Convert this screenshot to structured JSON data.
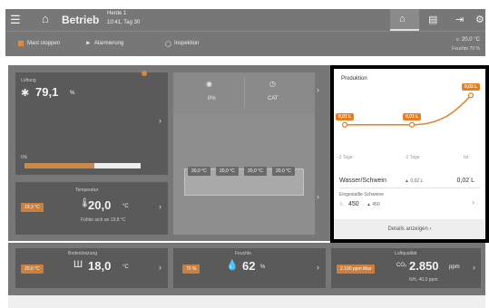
{
  "topbar": {
    "title": "Betrieb",
    "subtitle_line1": "Herde 1",
    "subtitle_line2": "10:41, Tag 30",
    "icons": [
      "menu-icon",
      "home-icon",
      "barn-icon",
      "document-icon",
      "logout-icon",
      "settings-icon"
    ]
  },
  "actions": {
    "stop_label": "Mast stoppen",
    "alarm_label": "Alarmierung",
    "inspection_label": "Inspektion",
    "outside_temp": "☼ 20,0 °C",
    "outside_humidity": "Feuchte 70 %"
  },
  "main": {
    "luftung": {
      "label": "Lüftung",
      "value": "79,1",
      "unit": "%",
      "bar_start": "0%",
      "bar_fill": 0.6
    },
    "center": {
      "left_value": "0%",
      "right_value": "CAT"
    },
    "temperatur": {
      "label": "Temperatur",
      "badge": "19,3 °C",
      "value": "20,0",
      "unit": "°C",
      "note": "Fühler sich an 19,8 °C"
    },
    "sensors": [
      "20,0 °C",
      "20,0 °C",
      "20,0 °C",
      "20,0 °C"
    ]
  },
  "bottom": {
    "bodenheizung": {
      "label": "Bodenheizung",
      "badge": "20,0 °C",
      "value": "18,0",
      "unit": "°C"
    },
    "feuchte": {
      "label": "Feuchte",
      "badge": "70 %",
      "value": "62",
      "unit": "%"
    },
    "luftqualitat": {
      "label": "Luftqualität",
      "badge": "2.100 ppm Max",
      "value": "2.850",
      "unit": "ppm",
      "note": "NH₃ 40,0 ppm"
    }
  },
  "production": {
    "title": "Produktion",
    "details_label": "Details anzeigen",
    "row1_label": "Wasser/Schwein",
    "row1_trend": "▲ 0,02 L",
    "row1_value": "0,02 L",
    "row2_label": "Eingestallte Schweine",
    "row2_value": "450",
    "row2_trend": "▲ 450"
  },
  "chart_data": {
    "type": "line",
    "categories": [
      "-2 Tage",
      "-1 Tage",
      "Ist"
    ],
    "series": [
      {
        "values": [
          0.01,
          0.01,
          0.02
        ]
      }
    ],
    "data_labels": [
      "0,01 L",
      "0,01 L",
      "0,02 L"
    ],
    "color": "#e67e22"
  }
}
